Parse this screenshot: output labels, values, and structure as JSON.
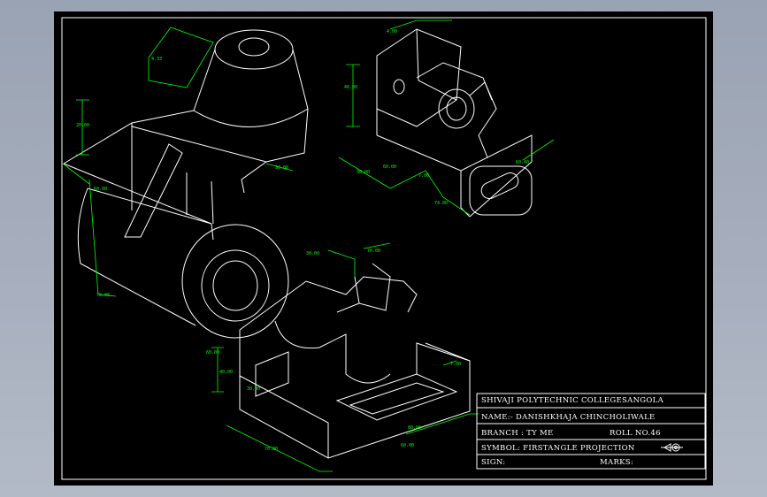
{
  "title_block": {
    "college": "SHIVAJI POLYTECHNIC COLLEGESANGOLA",
    "name": "NAME:-   DANISHKHAJA CHINCHOLIWALE",
    "branch": "BRANCH : TY ME",
    "roll": "ROLL NO.46",
    "symbol": "SYMBOL: FIRSTANGLE PROJECTION",
    "sign": "SIGN:",
    "marks": "MARKS:"
  },
  "dimensions": {
    "d1": "4.33",
    "d2": "20.00",
    "d3": "60.00",
    "d4": "30.00",
    "d5": "70.00",
    "d6": "4.00",
    "d7": "40.00",
    "d8": "30.00",
    "d9": "60.00",
    "d10": "7.00",
    "d11": "74.00",
    "d12": "60.00",
    "d13": "30.00",
    "d14": "70.00",
    "d15": "60.00",
    "d16": "40.00",
    "d17": "30.00",
    "d18": "7.00",
    "d19": "70.00",
    "d20": "80.00",
    "d21": "60.00"
  },
  "colors": {
    "sheet": "#000000",
    "geometry": "#ffffff",
    "dimension": "#00ff00"
  }
}
